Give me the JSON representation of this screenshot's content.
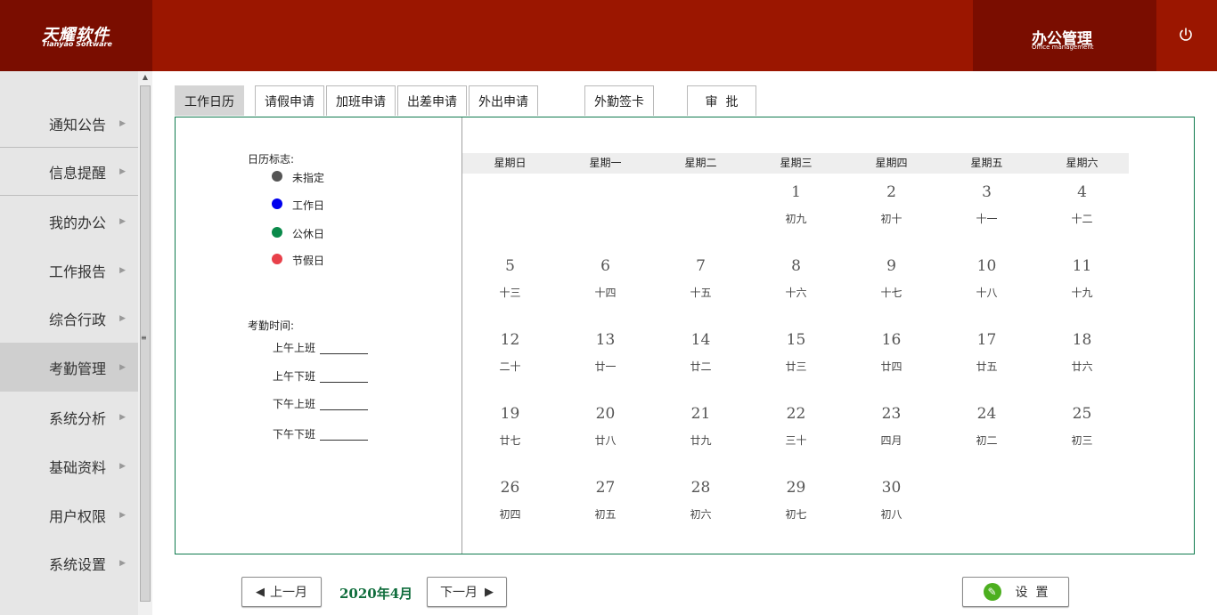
{
  "header": {
    "logo_cn": "天耀软件",
    "logo_en": "Tianyao Software",
    "module_cn": "办公管理",
    "module_en": "Office  management",
    "power_icon": "power-icon"
  },
  "sidebar": {
    "items": [
      {
        "label": "通知公告"
      },
      {
        "label": "信息提醒"
      },
      {
        "label": "我的办公"
      },
      {
        "label": "工作报告"
      },
      {
        "label": "综合行政"
      },
      {
        "label": "考勤管理"
      },
      {
        "label": "系统分析"
      },
      {
        "label": "基础资料"
      },
      {
        "label": "用户权限"
      },
      {
        "label": "系统设置"
      }
    ],
    "arrow": "▶",
    "scroll_up": "▲",
    "scroll_grip": "≡"
  },
  "tabs": [
    "工作日历",
    "请假申请",
    "加班申请",
    "出差申请",
    "外出申请",
    "外勤签卡",
    "审  批"
  ],
  "legend": {
    "title": "日历标志:",
    "items": [
      {
        "label": "未指定",
        "color": "#555555"
      },
      {
        "label": "工作日",
        "color": "#0000ee"
      },
      {
        "label": "公休日",
        "color": "#0a8a4a"
      },
      {
        "label": "节假日",
        "color": "#e8404a"
      }
    ]
  },
  "attendance": {
    "title": "考勤时间:",
    "items": [
      "上午上班",
      "上午下班",
      "下午上班",
      "下午下班"
    ]
  },
  "calendar": {
    "weekdays": [
      "星期日",
      "星期一",
      "星期二",
      "星期三",
      "星期四",
      "星期五",
      "星期六"
    ],
    "weeks": [
      [
        null,
        null,
        null,
        {
          "d": "1",
          "l": "初九"
        },
        {
          "d": "2",
          "l": "初十"
        },
        {
          "d": "3",
          "l": "十一"
        },
        {
          "d": "4",
          "l": "十二"
        }
      ],
      [
        {
          "d": "5",
          "l": "十三"
        },
        {
          "d": "6",
          "l": "十四"
        },
        {
          "d": "7",
          "l": "十五"
        },
        {
          "d": "8",
          "l": "十六"
        },
        {
          "d": "9",
          "l": "十七"
        },
        {
          "d": "10",
          "l": "十八"
        },
        {
          "d": "11",
          "l": "十九"
        }
      ],
      [
        {
          "d": "12",
          "l": "二十"
        },
        {
          "d": "13",
          "l": "廿一"
        },
        {
          "d": "14",
          "l": "廿二"
        },
        {
          "d": "15",
          "l": "廿三"
        },
        {
          "d": "16",
          "l": "廿四"
        },
        {
          "d": "17",
          "l": "廿五"
        },
        {
          "d": "18",
          "l": "廿六"
        }
      ],
      [
        {
          "d": "19",
          "l": "廿七"
        },
        {
          "d": "20",
          "l": "廿八"
        },
        {
          "d": "21",
          "l": "廿九"
        },
        {
          "d": "22",
          "l": "三十"
        },
        {
          "d": "23",
          "l": "四月"
        },
        {
          "d": "24",
          "l": "初二"
        },
        {
          "d": "25",
          "l": "初三"
        }
      ],
      [
        {
          "d": "26",
          "l": "初四"
        },
        {
          "d": "27",
          "l": "初五"
        },
        {
          "d": "28",
          "l": "初六"
        },
        {
          "d": "29",
          "l": "初七"
        },
        {
          "d": "30",
          "l": "初八"
        },
        null,
        null
      ]
    ]
  },
  "footer": {
    "prev_label": "上一月",
    "prev_icon": "◀",
    "current_month": "2020年4月",
    "next_label": "下一月",
    "next_icon": "▶",
    "settings_label": "设  置",
    "settings_icon": "✎"
  }
}
